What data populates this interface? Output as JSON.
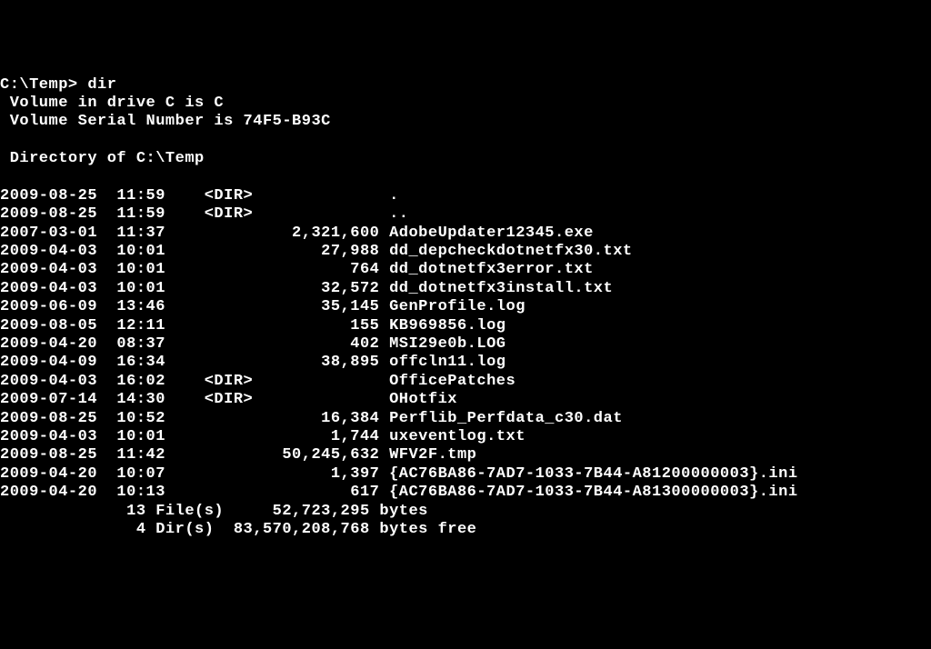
{
  "prompt": "C:\\Temp> ",
  "command": "dir",
  "volumeLine": " Volume in drive C is C",
  "serialLine": " Volume Serial Number is 74F5-B93C",
  "directoryLine": " Directory of C:\\Temp",
  "entries": [
    {
      "date": "2009-08-25",
      "time": "11:59",
      "type": "<DIR>",
      "size": "",
      "name": "."
    },
    {
      "date": "2009-08-25",
      "time": "11:59",
      "type": "<DIR>",
      "size": "",
      "name": ".."
    },
    {
      "date": "2007-03-01",
      "time": "11:37",
      "type": "",
      "size": "2,321,600",
      "name": "AdobeUpdater12345.exe"
    },
    {
      "date": "2009-04-03",
      "time": "10:01",
      "type": "",
      "size": "27,988",
      "name": "dd_depcheckdotnetfx30.txt"
    },
    {
      "date": "2009-04-03",
      "time": "10:01",
      "type": "",
      "size": "764",
      "name": "dd_dotnetfx3error.txt"
    },
    {
      "date": "2009-04-03",
      "time": "10:01",
      "type": "",
      "size": "32,572",
      "name": "dd_dotnetfx3install.txt"
    },
    {
      "date": "2009-06-09",
      "time": "13:46",
      "type": "",
      "size": "35,145",
      "name": "GenProfile.log"
    },
    {
      "date": "2009-08-05",
      "time": "12:11",
      "type": "",
      "size": "155",
      "name": "KB969856.log"
    },
    {
      "date": "2009-04-20",
      "time": "08:37",
      "type": "",
      "size": "402",
      "name": "MSI29e0b.LOG"
    },
    {
      "date": "2009-04-09",
      "time": "16:34",
      "type": "",
      "size": "38,895",
      "name": "offcln11.log"
    },
    {
      "date": "2009-04-03",
      "time": "16:02",
      "type": "<DIR>",
      "size": "",
      "name": "OfficePatches"
    },
    {
      "date": "2009-07-14",
      "time": "14:30",
      "type": "<DIR>",
      "size": "",
      "name": "OHotfix"
    },
    {
      "date": "2009-08-25",
      "time": "10:52",
      "type": "",
      "size": "16,384",
      "name": "Perflib_Perfdata_c30.dat"
    },
    {
      "date": "2009-04-03",
      "time": "10:01",
      "type": "",
      "size": "1,744",
      "name": "uxeventlog.txt"
    },
    {
      "date": "2009-08-25",
      "time": "11:42",
      "type": "",
      "size": "50,245,632",
      "name": "WFV2F.tmp"
    },
    {
      "date": "2009-04-20",
      "time": "10:07",
      "type": "",
      "size": "1,397",
      "name": "{AC76BA86-7AD7-1033-7B44-A81200000003}.ini"
    },
    {
      "date": "2009-04-20",
      "time": "10:13",
      "type": "",
      "size": "617",
      "name": "{AC76BA86-7AD7-1033-7B44-A81300000003}.ini"
    }
  ],
  "summary": {
    "fileCount": "13",
    "fileLabel": "File(s)",
    "totalBytes": "52,723,295",
    "bytesLabel": "bytes",
    "dirCount": "4",
    "dirLabel": "Dir(s)",
    "freeBytes": "83,570,208,768",
    "freeLabel": "bytes free"
  }
}
